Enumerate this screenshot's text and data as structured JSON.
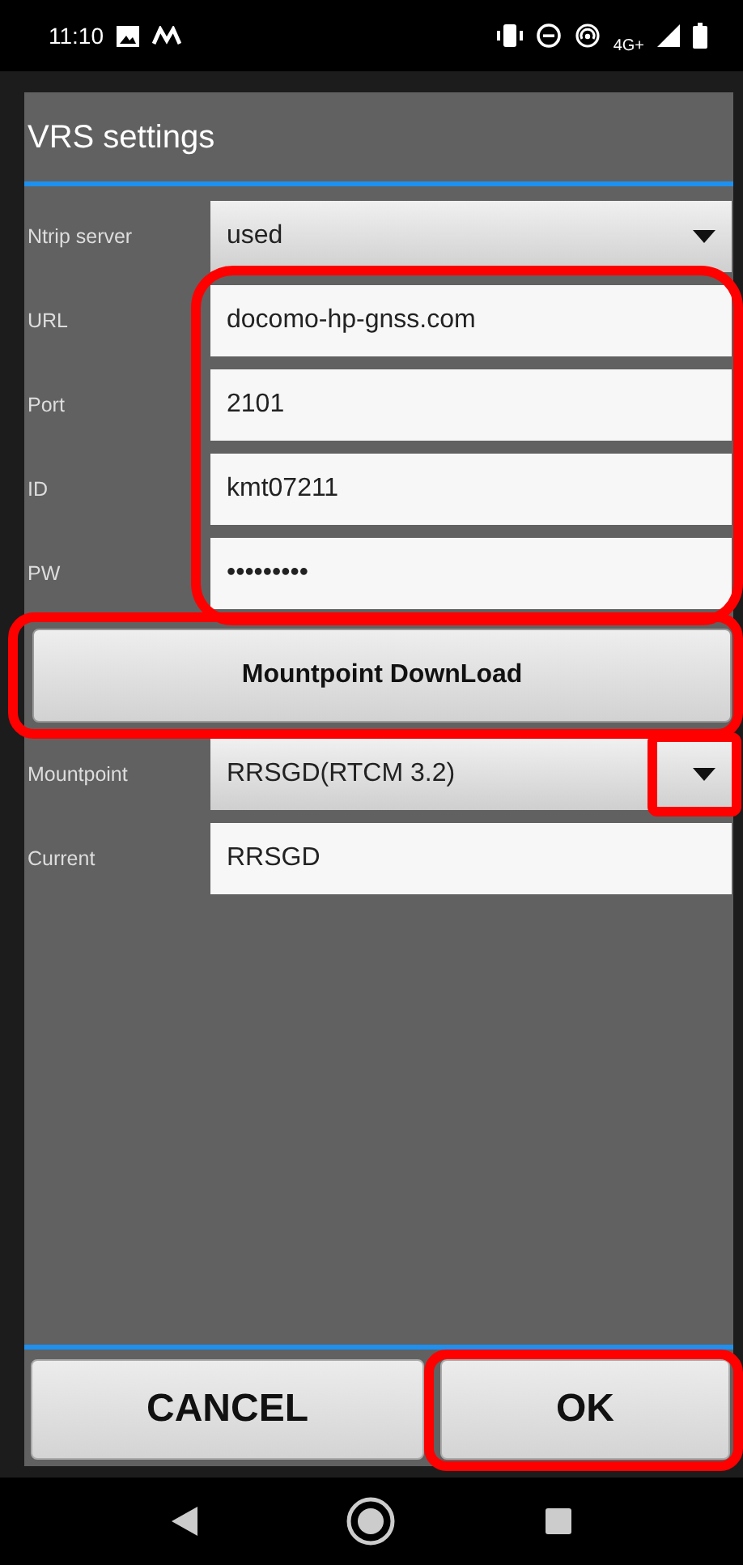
{
  "status_bar": {
    "time": "11:10",
    "network": "4G+"
  },
  "dialog": {
    "title": "VRS settings",
    "rows": [
      {
        "kind": "dropdown",
        "label": "Ntrip server",
        "value": "used"
      }
    ],
    "credentials": {
      "highlighted": true,
      "rows": [
        {
          "kind": "field",
          "label": "URL",
          "value": "docomo-hp-gnss.com"
        },
        {
          "kind": "field",
          "label": "Port",
          "value": "2101"
        },
        {
          "kind": "field",
          "label": "ID",
          "value": "kmt07211"
        },
        {
          "kind": "field",
          "label": "PW",
          "value": "•••••••••"
        }
      ]
    },
    "download_button": {
      "label": "Mountpoint DownLoad",
      "highlighted": true
    },
    "mount_rows": [
      {
        "kind": "dropdown",
        "label": "Mountpoint",
        "value": "RRSGD(RTCM 3.2)",
        "arrow_highlighted": true
      },
      {
        "kind": "field",
        "label": "Current",
        "value": "RRSGD"
      }
    ],
    "buttons": [
      {
        "label": "CANCEL",
        "highlighted": false
      },
      {
        "label": "OK",
        "highlighted": true
      }
    ]
  }
}
